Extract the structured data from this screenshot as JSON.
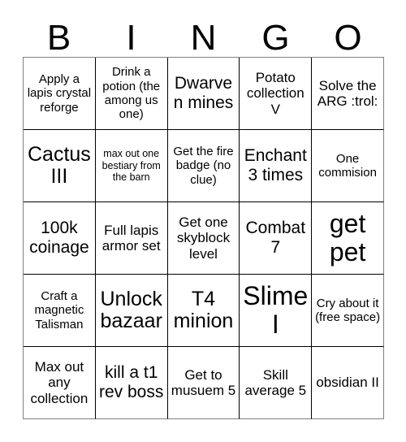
{
  "card": {
    "title": "BINGO",
    "header_letters": [
      "B",
      "I",
      "N",
      "G",
      "O"
    ],
    "colors": {
      "background": "#ffffff",
      "text": "#000000",
      "grid_line": "#000000",
      "outer_grid_line": "#808080"
    },
    "grid": {
      "columns": 5,
      "rows": 5
    },
    "cells": [
      {
        "text": "Apply a lapis crystal reforge",
        "size": "fs-s"
      },
      {
        "text": "Drink a potion (the among us one)",
        "size": "fs-s"
      },
      {
        "text": "Dwarven mines",
        "size": "fs-l"
      },
      {
        "text": "Potato collection V",
        "size": "fs-m"
      },
      {
        "text": "Solve the ARG :trol:",
        "size": "fs-m"
      },
      {
        "text": "Cactus III",
        "size": "fs-xl"
      },
      {
        "text": "max out one bestiary from the barn",
        "size": "fs-xs"
      },
      {
        "text": "Get the fire badge (no clue)",
        "size": "fs-s"
      },
      {
        "text": "Enchant 3 times",
        "size": "fs-l"
      },
      {
        "text": "One commision",
        "size": "fs-s"
      },
      {
        "text": "100k coinage",
        "size": "fs-l"
      },
      {
        "text": "Full lapis armor set",
        "size": "fs-m"
      },
      {
        "text": "Get one skyblock level",
        "size": "fs-m"
      },
      {
        "text": "Combat 7",
        "size": "fs-l"
      },
      {
        "text": "get pet",
        "size": "fs-xxl"
      },
      {
        "text": "Craft a magnetic Talisman",
        "size": "fs-s"
      },
      {
        "text": "Unlock bazaar",
        "size": "fs-xl"
      },
      {
        "text": "T4 minion",
        "size": "fs-xl"
      },
      {
        "text": "Slime I",
        "size": "fs-xxl"
      },
      {
        "text": "Cry about it (free space)",
        "size": "fs-s"
      },
      {
        "text": "Max out any collection",
        "size": "fs-m"
      },
      {
        "text": "kill a t1 rev boss",
        "size": "fs-l"
      },
      {
        "text": "Get to musuem 5",
        "size": "fs-m"
      },
      {
        "text": "Skill average 5",
        "size": "fs-m"
      },
      {
        "text": "obsidian II",
        "size": "fs-m"
      }
    ]
  }
}
